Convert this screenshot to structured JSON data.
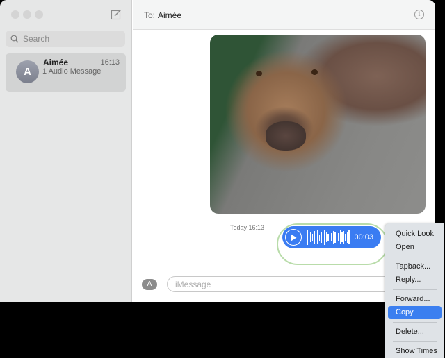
{
  "sidebar": {
    "search_placeholder": "Search",
    "conversations": [
      {
        "avatar_initial": "A",
        "name": "Aimée",
        "time": "16:13",
        "preview": "1 Audio Message"
      }
    ]
  },
  "header": {
    "to_label": "To:",
    "recipient": "Aimée",
    "info_icon": "i"
  },
  "thread": {
    "timestamp": "Today 16:13",
    "audio_message": {
      "duration": "00:03"
    }
  },
  "composer": {
    "apps_icon": "A",
    "placeholder": "iMessage",
    "value": ""
  },
  "context_menu": {
    "groups": [
      [
        "Quick Look",
        "Open"
      ],
      [
        "Tapback...",
        "Reply..."
      ],
      [
        "Forward...",
        "Copy"
      ],
      [
        "Delete..."
      ],
      [
        "Show Times"
      ]
    ],
    "highlighted": "Copy"
  },
  "colors": {
    "accent": "#3a7cf2",
    "highlight_border": "#b9dcaa"
  }
}
